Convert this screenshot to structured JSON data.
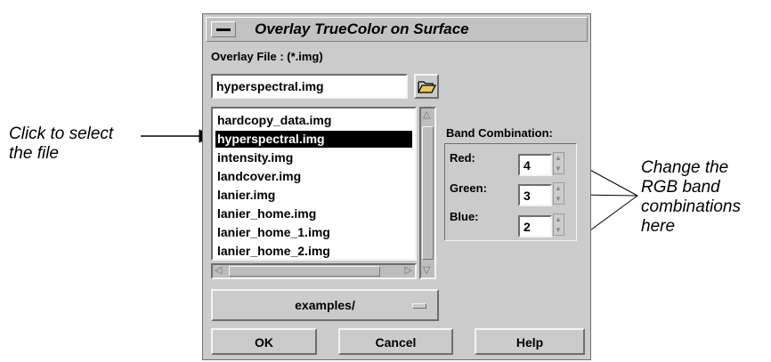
{
  "dialog": {
    "title": "Overlay TrueColor on Surface",
    "overlay_file_label": "Overlay File : (*.img)",
    "file_input_value": "hyperspectral.img",
    "files": [
      "hardcopy_data.img",
      "hyperspectral.img",
      "intensity.img",
      "landcover.img",
      "lanier.img",
      "lanier_home.img",
      "lanier_home_1.img",
      "lanier_home_2.img"
    ],
    "selected_file": "hyperspectral.img",
    "directory": "examples/",
    "band_combination": {
      "label": "Band Combination:",
      "red_label": "Red:",
      "red_value": "4",
      "green_label": "Green:",
      "green_value": "3",
      "blue_label": "Blue:",
      "blue_value": "2"
    },
    "buttons": {
      "ok": "OK",
      "cancel": "Cancel",
      "help": "Help"
    }
  },
  "annotations": {
    "left_line1": "Click to select",
    "left_line2": "the file",
    "right_line1": "Change the",
    "right_line2": "RGB band",
    "right_line3": "combinations",
    "right_line4": "here"
  },
  "icons": [
    "window-menu-icon",
    "folder-open-icon",
    "scroll-arrow-icon",
    "spinner-arrow-icon"
  ]
}
